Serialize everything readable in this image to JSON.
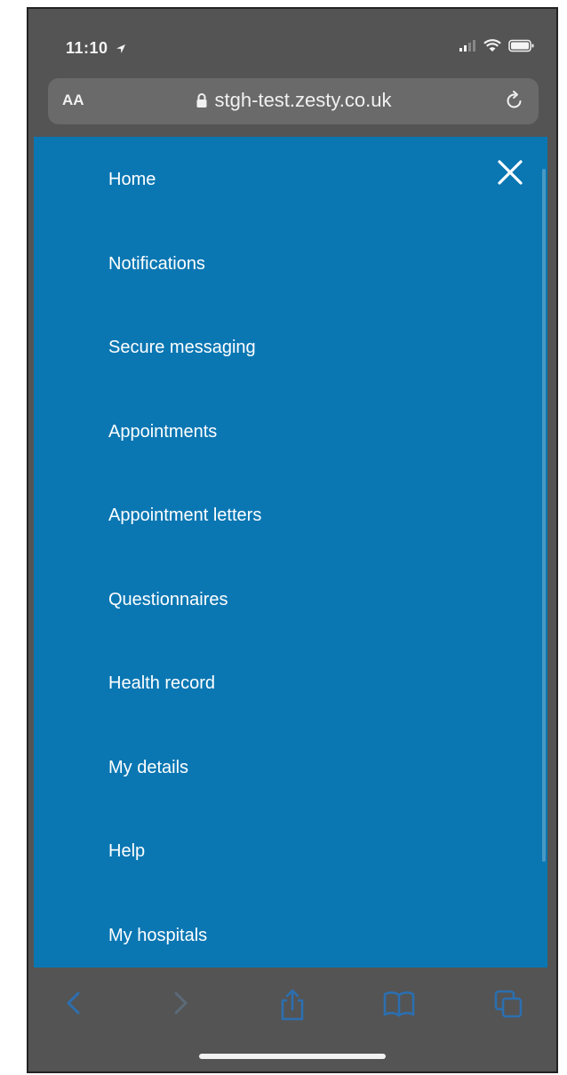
{
  "status_bar": {
    "time": "11:10"
  },
  "url_bar": {
    "text_size_label": "AA",
    "url": "stgh-test.zesty.co.uk"
  },
  "menu": {
    "items": [
      {
        "label": "Home"
      },
      {
        "label": "Notifications"
      },
      {
        "label": "Secure messaging"
      },
      {
        "label": "Appointments"
      },
      {
        "label": "Appointment letters"
      },
      {
        "label": "Questionnaires"
      },
      {
        "label": "Health record"
      },
      {
        "label": "My details"
      },
      {
        "label": "Help"
      },
      {
        "label": "My hospitals"
      }
    ]
  },
  "colors": {
    "menu_background": "#0a77b3",
    "browser_chrome": "#545454",
    "toolbar_icon": "#2b6fb0"
  },
  "icons": {
    "close": "close-icon",
    "back": "back-arrow-icon",
    "forward": "forward-arrow-icon",
    "share": "share-icon",
    "bookmarks": "bookmarks-icon",
    "tabs": "tabs-icon"
  }
}
